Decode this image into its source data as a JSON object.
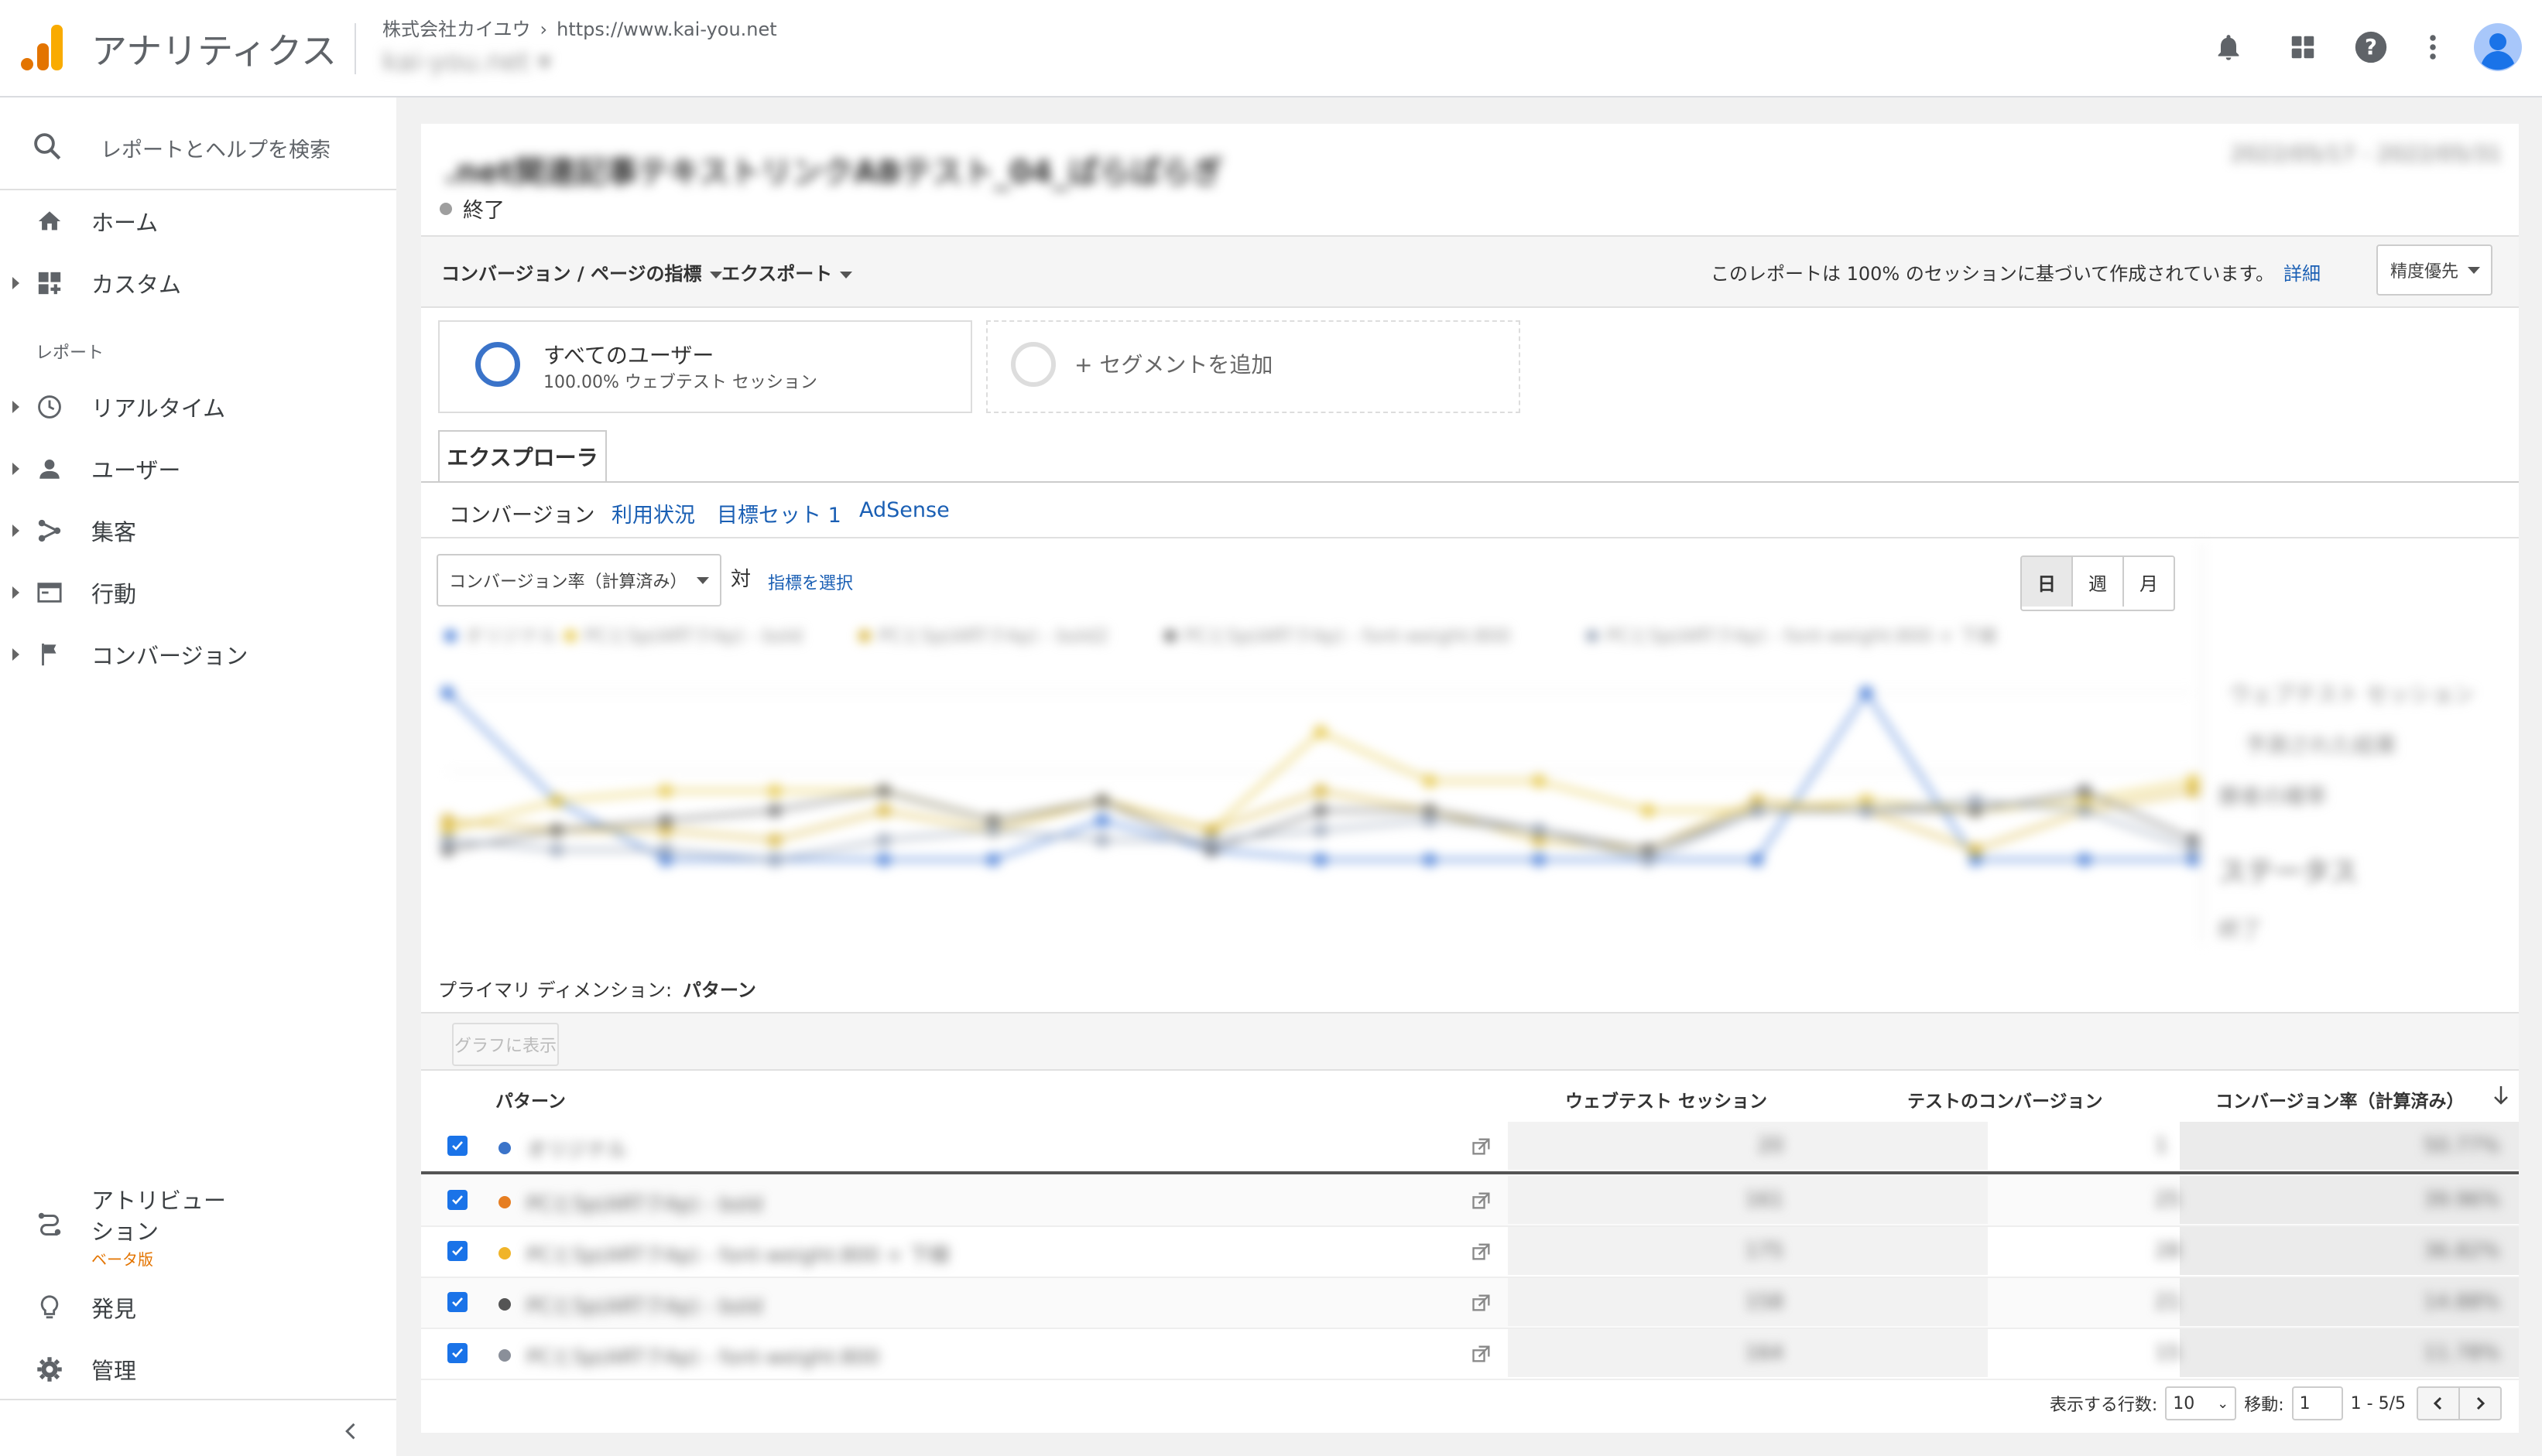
{
  "header": {
    "app_title": "アナリティクス",
    "account": "株式会社カイユウ",
    "property": "https://www.kai-you.net",
    "view": "kai-you.net"
  },
  "sidebar": {
    "search_placeholder": "レポートとヘルプを検索",
    "home": "ホーム",
    "custom": "カスタム",
    "section_reports": "レポート",
    "realtime": "リアルタイム",
    "users": "ユーザー",
    "acquisition": "集客",
    "behavior": "行動",
    "conversions": "コンバージョン",
    "attribution": "アトリビューション",
    "attribution_badge": "ベータ版",
    "discover": "発見",
    "admin": "管理"
  },
  "report": {
    "title": ".net関連記事テキストリンクABテスト_04_ぱらぱらぎ",
    "status": "終了",
    "date_range": "2022/05/17 - 2022/05/31",
    "toolbar": {
      "metrics_menu": "コンバージョン / ページの指標",
      "export": "エクスポート",
      "sampling_note": "このレポートは 100% のセッションに基づいて作成されています。",
      "details_link": "詳細",
      "precision": "精度優先"
    },
    "segments": {
      "all_users": "すべてのユーザー",
      "all_users_sub": "100.00% ウェブテスト セッション",
      "add_segment": "+ セグメントを追加"
    },
    "explorer_tab": "エクスプローラ",
    "subtabs": [
      "コンバージョン",
      "利用状況",
      "目標セット 1",
      "AdSense"
    ],
    "metric_select": "コンバージョン率（計算済み）",
    "vs": "対",
    "select_metric": "指標を選択",
    "period": [
      "日",
      "週",
      "月"
    ],
    "primary_dimension_label": "プライマリ ディメンション:",
    "primary_dimension_value": "パターン",
    "graph_button": "グラフに表示",
    "side_panel": [
      "ウェブテスト セッション",
      "予測された結果",
      "勝者の確率",
      "ステータス",
      "終了"
    ]
  },
  "chart_data": {
    "type": "line",
    "title": "",
    "series": [
      {
        "name": "オリジナル",
        "color": "#4a7fd8",
        "values": [
          0.9,
          0.35,
          0.05,
          0.05,
          0.05,
          0.05,
          0.25,
          0.1,
          0.05,
          0.05,
          0.05,
          0.05,
          0.05,
          0.9,
          0.05,
          0.05,
          0.05
        ]
      },
      {
        "name": "PCとSp(ARTクAp) - bold",
        "color": "#e6c84a",
        "values": [
          0.2,
          0.35,
          0.4,
          0.4,
          0.4,
          0.25,
          0.35,
          0.2,
          0.7,
          0.45,
          0.45,
          0.3,
          0.3,
          0.35,
          0.3,
          0.35,
          0.45
        ]
      },
      {
        "name": "PCとSp(ARTクAp) - bold2",
        "color": "#d8b640",
        "values": [
          0.25,
          0.2,
          0.2,
          0.15,
          0.3,
          0.2,
          0.35,
          0.2,
          0.4,
          0.3,
          0.15,
          0.1,
          0.35,
          0.3,
          0.1,
          0.3,
          0.4
        ]
      },
      {
        "name": "PCとSp(ARTクAp) - font-weight:800",
        "color": "#7a7a7a",
        "values": [
          0.1,
          0.2,
          0.25,
          0.3,
          0.4,
          0.25,
          0.35,
          0.1,
          0.3,
          0.3,
          0.2,
          0.1,
          0.3,
          0.3,
          0.3,
          0.4,
          0.15
        ]
      },
      {
        "name": "PCとSp(ARTクAp) - font-weight:800 + 下線",
        "color": "#9aa6b8",
        "values": [
          0.15,
          0.1,
          0.1,
          0.05,
          0.15,
          0.2,
          0.15,
          0.15,
          0.2,
          0.25,
          0.2,
          0.05,
          0.3,
          0.3,
          0.35,
          0.3,
          0.1
        ]
      }
    ]
  },
  "table": {
    "headers": [
      "パターン",
      "ウェブテスト セッション",
      "テストのコンバージョン",
      "コンバージョン率（計算済み）"
    ],
    "rows": [
      {
        "name": "オリジナル",
        "color": "#3a73c9",
        "sessions": "20",
        "conversions": "1",
        "rate": "50.77%"
      },
      {
        "name": "PCとSp(ARTクAp) - bold",
        "color": "#e67e22",
        "sessions": "161",
        "conversions": "25",
        "rate": "39.96%"
      },
      {
        "name": "PCとSp(ARTクAp) - font-weight:800 + 下線",
        "color": "#f0b429",
        "sessions": "175",
        "conversions": "28",
        "rate": "36.82%"
      },
      {
        "name": "PCとSp(ARTクAp) - bold",
        "color": "#555555",
        "sessions": "158",
        "conversions": "21",
        "rate": "14.88%"
      },
      {
        "name": "PCとSp(ARTクAp) - font-weight:800",
        "color": "#8a8f99",
        "sessions": "164",
        "conversions": "15",
        "rate": "11.78%"
      }
    ]
  },
  "pagination": {
    "rows_label": "表示する行数:",
    "rows_value": "10",
    "goto_label": "移動:",
    "goto_value": "1",
    "range": "1 - 5/5"
  },
  "colors": {
    "accent": "#1a73e8",
    "logo_orange": "#f9ab00",
    "logo_dark_orange": "#e37400"
  }
}
